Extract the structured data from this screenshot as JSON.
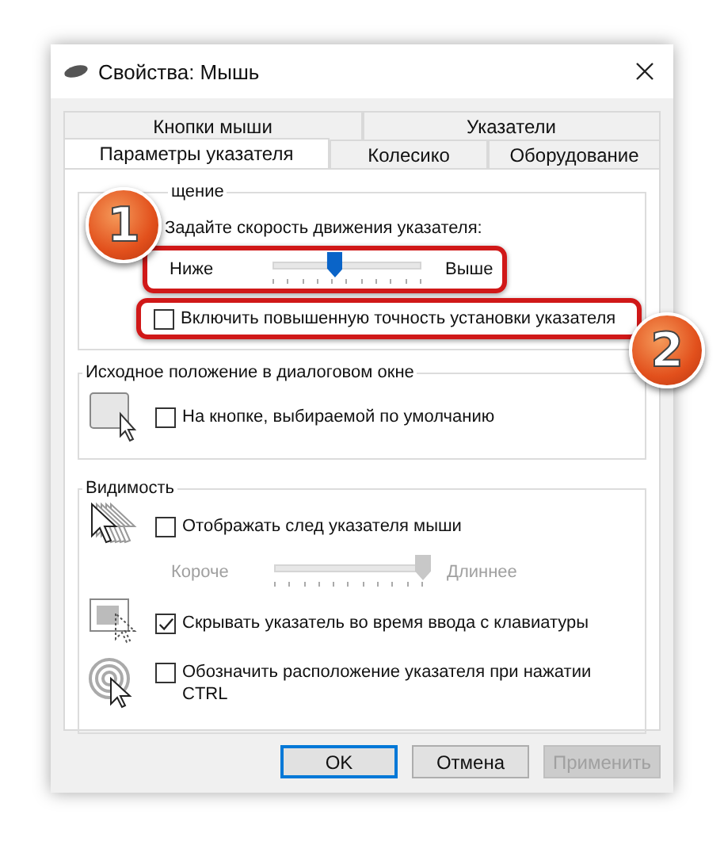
{
  "window": {
    "title": "Свойства: Мышь"
  },
  "tab_rows": [
    [
      {
        "label": "Кнопки мыши",
        "selected": false
      },
      {
        "label": "Указатели",
        "selected": false
      }
    ],
    [
      {
        "label": "Параметры указателя",
        "selected": true
      },
      {
        "label": "Колесико",
        "selected": false
      },
      {
        "label": "Оборудование",
        "selected": false
      }
    ]
  ],
  "groups": [
    {
      "title": "щение",
      "items": [
        {
          "kind": "label",
          "text": "Задайте скорость движения указателя:"
        },
        {
          "kind": "slider",
          "min_label": "Ниже",
          "max_label": "Выше",
          "level": 0.42,
          "disabled": false,
          "highlighted": true
        },
        {
          "kind": "checkbox",
          "label": "Включить повышенную точность установки указателя",
          "checked": false,
          "highlighted": true
        }
      ]
    },
    {
      "title": "Исходное положение в диалоговом окне",
      "items": [
        {
          "kind": "checkbox",
          "label": "На кнопке, выбираемой по умолчанию",
          "checked": false
        }
      ]
    },
    {
      "title": "Видимость",
      "items": [
        {
          "kind": "checkbox",
          "label": "Отображать след указателя мыши",
          "checked": false
        },
        {
          "kind": "slider",
          "min_label": "Короче",
          "max_label": "Длиннее",
          "level": 1,
          "disabled": true
        },
        {
          "kind": "checkbox",
          "label": "Скрывать указатель во время ввода с клавиатуры",
          "checked": true
        },
        {
          "kind": "checkbox",
          "label": "Обозначить расположение указателя при нажатии CTRL",
          "checked": false
        }
      ]
    }
  ],
  "buttons": [
    {
      "label": "OK",
      "default": true,
      "disabled": false
    },
    {
      "label": "Отмена",
      "default": false,
      "disabled": false
    },
    {
      "label": "Применить",
      "default": false,
      "disabled": true
    }
  ],
  "callouts": [
    {
      "number": "1"
    },
    {
      "number": "2"
    }
  ]
}
